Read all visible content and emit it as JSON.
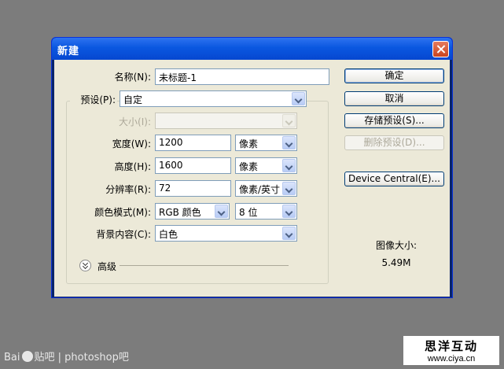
{
  "dialog": {
    "title": "新建",
    "name_label": "名称(N):",
    "name_value": "未标题-1",
    "preset_label": "预设(P):",
    "preset_value": "自定",
    "size_label": "大小(I):",
    "width_label": "宽度(W):",
    "width_value": "1200",
    "width_unit": "像素",
    "height_label": "高度(H):",
    "height_value": "1600",
    "height_unit": "像素",
    "resolution_label": "分辨率(R):",
    "resolution_value": "72",
    "resolution_unit": "像素/英寸",
    "color_mode_label": "颜色模式(M):",
    "color_mode_value": "RGB 颜色",
    "bit_depth_value": "8 位",
    "bg_label": "背景内容(C):",
    "bg_value": "白色",
    "advanced_label": "高级"
  },
  "buttons": {
    "ok": "确定",
    "cancel": "取消",
    "save_preset": "存储预设(S)...",
    "delete_preset": "删除预设(D)...",
    "device_central": "Device Central(E)..."
  },
  "image_size": {
    "label": "图像大小:",
    "value": "5.49M"
  },
  "watermark": {
    "baidu_prefix": "Bai",
    "baidu_suffix": "贴吧",
    "forum": "| photoshop吧",
    "logo_text": "思洋互动",
    "logo_url": "www.ciya.cn"
  }
}
